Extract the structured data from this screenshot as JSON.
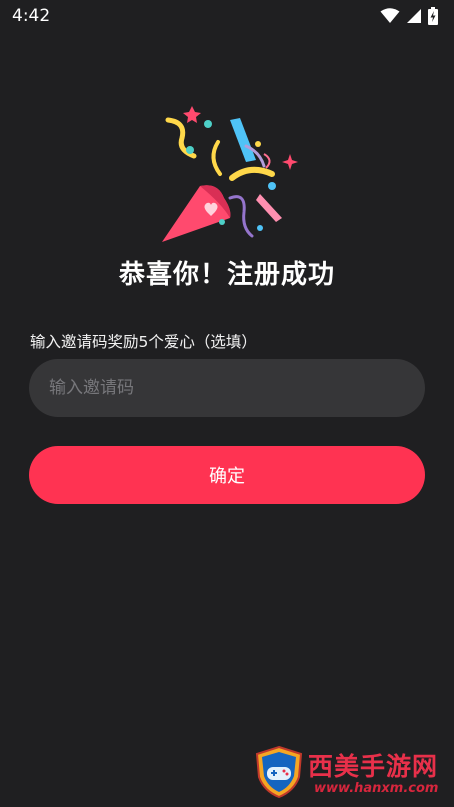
{
  "status_bar": {
    "time": "4:42",
    "icons": [
      "wifi-icon",
      "signal-icon",
      "battery-charging-icon"
    ]
  },
  "hero": {
    "icon": "party-popper-icon",
    "title": "恭喜你！注册成功"
  },
  "invite": {
    "label": "输入邀请码奖励5个爱心（选填）",
    "placeholder": "输入邀请码",
    "value": ""
  },
  "confirm": {
    "label": "确定"
  },
  "watermark": {
    "brand": "西美手游网",
    "url": "www.hanxm.com"
  },
  "colors": {
    "background": "#1f1f21",
    "input_bg": "#363638",
    "accent": "#ff3352",
    "text": "#ffffff"
  }
}
